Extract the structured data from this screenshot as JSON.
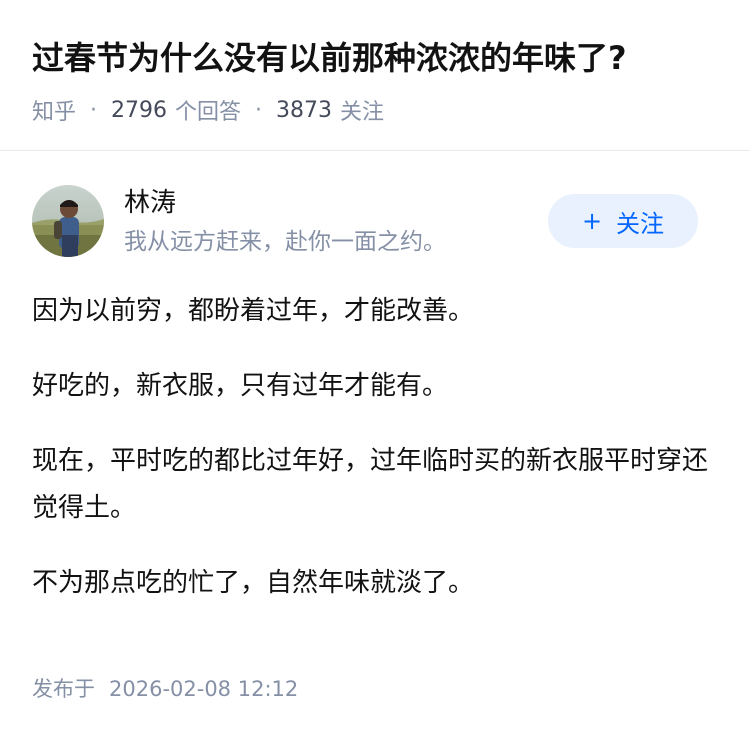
{
  "question": {
    "title": "过春节为什么没有以前那种浓浓的年味了?",
    "source": "知乎",
    "answer_count": "2796",
    "answer_label": "个回答",
    "follower_count": "3873",
    "follower_label": "关注",
    "separator": "·"
  },
  "author": {
    "name": "林涛",
    "bio": "我从远方赶来，赴你一面之约。",
    "avatar_icon": "user-avatar-photo",
    "follow_plus": "+",
    "follow_label": "关注"
  },
  "answer": {
    "paragraphs": [
      "因为以前穷，都盼着过年，才能改善。",
      "好吃的，新衣服，只有过年才能有。",
      "现在，平时吃的都比过年好，过年临时买的新衣服平时穿还觉得土。",
      "不为那点吃的忙了，自然年味就淡了。"
    ],
    "publish_label": "发布于",
    "publish_time": "2026-02-08 12:12"
  },
  "colors": {
    "accent": "#0066ff",
    "follow_bg": "#e8f1fd",
    "meta_gray": "#8590a6",
    "text": "#121212"
  }
}
